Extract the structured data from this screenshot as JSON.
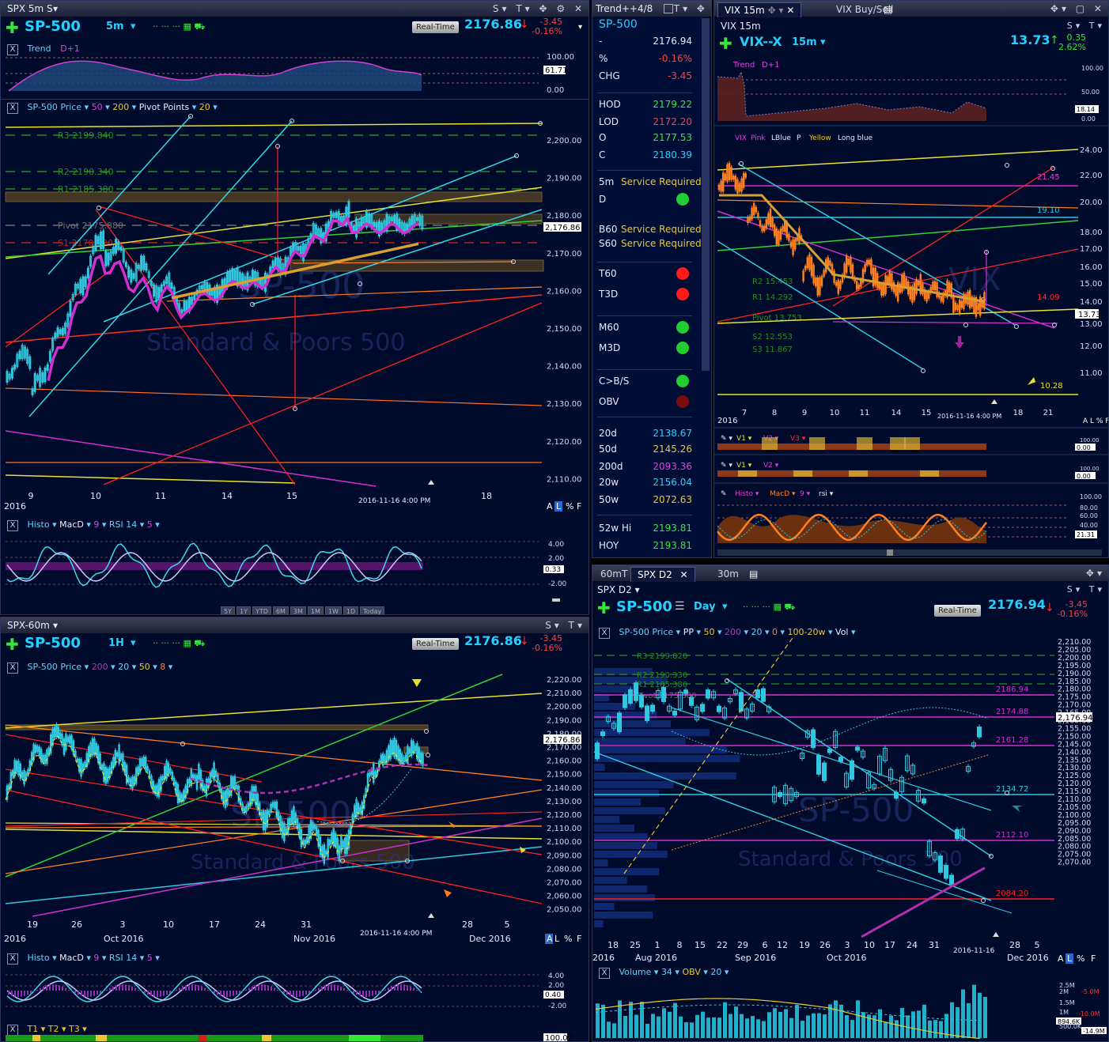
{
  "panel_5m": {
    "window_title": "SPX 5m S",
    "symbol": "SP-500",
    "interval": "5m",
    "realtime_label": "Real-Time",
    "price": "2176.86",
    "change": "-3.45",
    "change_pct": "-0.16%",
    "trend_label": "Trend",
    "trend_extra": "D+1",
    "trend_axis": [
      "100.00",
      "61.71",
      "0.00"
    ],
    "price_study": "SP-500 Price",
    "p1": "50",
    "p2": "200",
    "pivot_label": "Pivot Points",
    "pivot_n": "20",
    "pivot_levels": [
      "R3 2199.840",
      "R2 2190.340",
      "R1 2185.380",
      "Pivot 2175.880",
      "S1 2170.920"
    ],
    "y_ticks": [
      "2,200.00",
      "2,190.00",
      "2,180.00",
      "2,170.00",
      "2,160.00",
      "2,150.00",
      "2,140.00",
      "2,130.00",
      "2,120.00",
      "2,110.00"
    ],
    "last_tag": "2,176.86",
    "x_ticks": [
      "9",
      "10",
      "11",
      "14",
      "15",
      "18"
    ],
    "year": "2016",
    "timestamp": "2016-11-16 4:00 PM",
    "afl": [
      "A",
      "L",
      "%",
      "F"
    ],
    "watermark1": "SP-500",
    "watermark2": "Standard & Poors 500",
    "osc_labels": [
      "Histo",
      "MacD",
      "9",
      "RSI 14",
      "5"
    ],
    "osc_axis": [
      "4.00",
      "2.00",
      "0.33",
      "-2.00"
    ],
    "range_buttons": [
      "5Y",
      "1Y",
      "YTD",
      "6M",
      "3M",
      "1M",
      "1W",
      "1D",
      "Today"
    ]
  },
  "watchlist": {
    "title": "Trend++4/8",
    "symbol": "SP-500",
    "rows": [
      {
        "k": "-",
        "v": "2176.94",
        "c": "#e6eaff"
      },
      {
        "k": "%",
        "v": "-0.16%",
        "c": "#ff4040"
      },
      {
        "k": "CHG",
        "v": "-3.45",
        "c": "#ff4040"
      },
      {
        "k": "HOD",
        "v": "2179.22",
        "c": "#35e835"
      },
      {
        "k": "LOD",
        "v": "2172.20",
        "c": "#ff4040"
      },
      {
        "k": "O",
        "v": "2177.53",
        "c": "#35e835"
      },
      {
        "k": "C",
        "v": "2180.39",
        "c": "#25d0ff"
      }
    ],
    "service": [
      {
        "k": "5m",
        "v": "Service Required"
      },
      {
        "k": "B60",
        "v": "Service Required"
      },
      {
        "k": "S60",
        "v": "Service Required"
      }
    ],
    "d_label": "D",
    "signals": [
      {
        "k": "T60",
        "c": "#ff1a1a"
      },
      {
        "k": "T3D",
        "c": "#ff1a1a"
      },
      {
        "k": "M60",
        "c": "#22cc33"
      },
      {
        "k": "M3D",
        "c": "#22cc33"
      },
      {
        "k": "C>B/S",
        "c": "#22cc33"
      },
      {
        "k": "OBV",
        "c": "#7a0d0d"
      }
    ],
    "mas": [
      {
        "k": "20d",
        "v": "2138.67",
        "c": "#25d0ff"
      },
      {
        "k": "50d",
        "v": "2145.26",
        "c": "#e8c830"
      },
      {
        "k": "200d",
        "v": "2093.36",
        "c": "#e040e0"
      },
      {
        "k": "20w",
        "v": "2156.04",
        "c": "#25d0ff"
      },
      {
        "k": "50w",
        "v": "2072.63",
        "c": "#e8c830"
      },
      {
        "k": "52w Hi",
        "v": "2193.81",
        "c": "#35e835"
      },
      {
        "k": "HOY",
        "v": "2193.81",
        "c": "#35e835"
      }
    ]
  },
  "panel_vix": {
    "tab1": "VIX 15m",
    "tab2": "VIX Buy/Sell",
    "window_title": "VIX 15m",
    "symbol": "VIX--X",
    "interval": "15m",
    "price": "13.73",
    "change": "0.35",
    "change_pct": "2.62%",
    "trend_label": "Trend",
    "trend_extra": "D+1",
    "trend_axis": [
      "100.00",
      "50.00",
      "18.14",
      "0.00"
    ],
    "legend": [
      "VIX",
      "Pink",
      "LBlue",
      "P",
      "Yellow",
      "Long blue"
    ],
    "y_ticks": [
      "24.00",
      "22.00",
      "20.00",
      "18.00",
      "17.00",
      "16.00",
      "15.00",
      "14.00",
      "13.00",
      "12.00",
      "11.00"
    ],
    "levels": [
      "21.45",
      "19.10",
      "14.09",
      "13.73",
      "10.28"
    ],
    "pivots": [
      "R2 15.453",
      "R1 14.292",
      "Pivot 13.753",
      "S2 12.553",
      "S3 11.867"
    ],
    "x_ticks": [
      "7",
      "8",
      "9",
      "10",
      "11",
      "14",
      "15",
      "18",
      "21"
    ],
    "year": "2016",
    "timestamp": "2016-11-16 4:00 PM",
    "vol1_labels": [
      "V1",
      "V2",
      "V3"
    ],
    "vol2_labels": [
      "V1",
      "V2"
    ],
    "osc_labels": [
      "Histo",
      "MacD",
      "9",
      "rsi"
    ],
    "osc_axis": [
      "100.00",
      "80.00",
      "60.00",
      "40.00",
      "21.31"
    ],
    "small_axis1": [
      "100.00",
      "0.00"
    ],
    "small_axis2": [
      "100.00",
      "0.00"
    ]
  },
  "panel_60m": {
    "window_title": "SPX-60m",
    "symbol": "SP-500",
    "interval": "1H",
    "realtime_label": "Real-Time",
    "price": "2176.86",
    "change": "-3.45",
    "change_pct": "-0.16%",
    "price_study": "SP-500 Price",
    "p1": "200",
    "p2": "20",
    "p3": "50",
    "p4": "8",
    "y_ticks": [
      "2,220.00",
      "2,210.00",
      "2,200.00",
      "2,190.00",
      "2,180.00",
      "2,170.00",
      "2,160.00",
      "2,150.00",
      "2,140.00",
      "2,130.00",
      "2,120.00",
      "2,110.00",
      "2,100.00",
      "2,090.00",
      "2,080.00",
      "2,070.00",
      "2,060.00",
      "2,050.00"
    ],
    "last_tag": "2,176.86",
    "x_ticks": [
      "19",
      "26",
      "3",
      "10",
      "17",
      "24",
      "31",
      "7",
      "28",
      "5"
    ],
    "month_ticks": [
      "2016",
      "Oct 2016",
      "Nov 2016",
      "Dec 2016"
    ],
    "timestamp": "2016-11-16 4:00 PM",
    "watermark1": "SP-500",
    "watermark2": "Standard & Poors 500",
    "osc_labels": [
      "Histo",
      "MacD",
      "9",
      "RSI 14",
      "5"
    ],
    "osc_axis": [
      "4.00",
      "2.00",
      "0.40",
      "-2.00"
    ],
    "t_labels": [
      "T1",
      "T2",
      "T3"
    ],
    "t_axis": "100.00"
  },
  "panel_d2": {
    "tab1": "60mT",
    "tab2": "SPX D2",
    "tab3": "30m",
    "window_title": "SPX D2",
    "symbol": "SP-500",
    "interval": "Day",
    "realtime_label": "Real-Time",
    "price": "2176.94",
    "change": "-3.45",
    "change_pct": "-0.16%",
    "price_study": "SP-500 Price",
    "legend": [
      "PP",
      "50",
      "200",
      "20",
      "0",
      "100-20w",
      "Vol"
    ],
    "pivots": [
      "R3 2199.820",
      "R2 2190.330",
      "R1 2185.380",
      "Pivot 2175.880"
    ],
    "y_ticks": [
      "2,210.00",
      "2,205.00",
      "2,200.00",
      "2,195.00",
      "2,190.00",
      "2,185.00",
      "2,180.00",
      "2,175.00",
      "2,170.00",
      "2,165.00",
      "2,160.00",
      "2,155.00",
      "2,150.00",
      "2,145.00",
      "2,140.00",
      "2,135.00",
      "2,130.00",
      "2,125.00",
      "2,120.00",
      "2,115.00",
      "2,110.00",
      "2,105.00",
      "2,100.00",
      "2,095.00",
      "2,090.00",
      "2,085.00",
      "2,080.00",
      "2,075.00",
      "2,070.00"
    ],
    "levels": [
      "2186.94",
      "2174.88",
      "2161.28",
      "2134.72",
      "2112.10",
      "2084.20"
    ],
    "last_tag": "2,176.94",
    "x_ticks": [
      "18",
      "25",
      "1",
      "8",
      "15",
      "22",
      "29",
      "6",
      "12",
      "19",
      "26",
      "3",
      "10",
      "17",
      "24",
      "31",
      "28",
      "5"
    ],
    "month_ticks": [
      "2016",
      "Aug 2016",
      "Sep 2016",
      "Oct 2016",
      "Dec 2016"
    ],
    "timestamp": "2016-11-16",
    "watermark1": "SP-500",
    "watermark2": "Standard & Poors 500",
    "vol_labels": [
      "Volume",
      "34",
      "OBV",
      "20"
    ],
    "vol_axis": [
      "2.5M",
      "2M",
      "1.5M",
      "1M",
      "894.6K",
      "500.0K",
      "-5.0M",
      "-10.0M",
      "-14.9M"
    ]
  }
}
